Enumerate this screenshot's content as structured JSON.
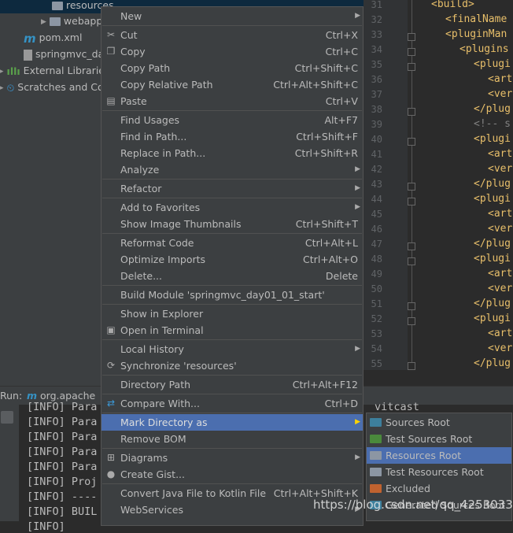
{
  "tree": [
    {
      "label": "resources",
      "icon": "folder-icon",
      "indent": 1,
      "selected": true
    },
    {
      "label": "webapp",
      "icon": "folder-icon",
      "indent": 1,
      "collapsed": true
    },
    {
      "label": "pom.xml",
      "icon": "maven-icon",
      "indent": 0
    },
    {
      "label": "springmvc_da",
      "icon": "iml-file-icon",
      "indent": 0
    },
    {
      "label": "External Libraries",
      "icon": "library-icon",
      "indent": 0
    },
    {
      "label": "Scratches and Co",
      "icon": "scratches-icon",
      "indent": 0
    }
  ],
  "editor": {
    "line_numbers": [
      "31",
      "32",
      "33",
      "34",
      "35",
      "36",
      "37",
      "38",
      "39",
      "40",
      "41",
      "42",
      "43",
      "44",
      "45",
      "46",
      "47",
      "48",
      "49",
      "50",
      "51",
      "52",
      "53",
      "54",
      "55"
    ],
    "lines": [
      {
        "text": "<build>",
        "indent": 1
      },
      {
        "text": "<finalName",
        "indent": 2
      },
      {
        "text": "<pluginMan",
        "indent": 2
      },
      {
        "text": "<plugins",
        "indent": 3
      },
      {
        "text": "<plugi",
        "indent": 4
      },
      {
        "text": "<art",
        "indent": 5
      },
      {
        "text": "<ver",
        "indent": 5
      },
      {
        "text": "</plug",
        "indent": 4
      },
      {
        "text": "<!-- s",
        "indent": 4,
        "comment": true
      },
      {
        "text": "<plugi",
        "indent": 4
      },
      {
        "text": "<art",
        "indent": 5
      },
      {
        "text": "<ver",
        "indent": 5
      },
      {
        "text": "</plug",
        "indent": 4
      },
      {
        "text": "<plugi",
        "indent": 4
      },
      {
        "text": "<art",
        "indent": 5
      },
      {
        "text": "<ver",
        "indent": 5
      },
      {
        "text": "</plug",
        "indent": 4
      },
      {
        "text": "<plugi",
        "indent": 4
      },
      {
        "text": "<art",
        "indent": 5
      },
      {
        "text": "<ver",
        "indent": 5
      },
      {
        "text": "</plug",
        "indent": 4
      },
      {
        "text": "<plugi",
        "indent": 4
      },
      {
        "text": "<art",
        "indent": 5
      },
      {
        "text": "<ver",
        "indent": 5
      },
      {
        "text": "</plug",
        "indent": 4
      }
    ]
  },
  "run": {
    "label": "Run:",
    "tab": "org.apache",
    "console": [
      "[INFO] Para",
      "[INFO] Para",
      "[INFO] Para",
      "[INFO] Para",
      "[INFO] Para",
      "[INFO] Proj",
      "[INFO] ----",
      "[INFO] BUIL",
      "[INFO]"
    ],
    "console_tail": "vitcast"
  },
  "menu": [
    {
      "label": "New",
      "submenu": true
    },
    {
      "sep": true
    },
    {
      "label": "Cut",
      "shortcut": "Ctrl+X",
      "icon": "scissors-icon",
      "glyph": "✂"
    },
    {
      "label": "Copy",
      "shortcut": "Ctrl+C",
      "icon": "copy-icon",
      "glyph": "❐"
    },
    {
      "label": "Copy Path",
      "shortcut": "Ctrl+Shift+C"
    },
    {
      "label": "Copy Relative Path",
      "shortcut": "Ctrl+Alt+Shift+C"
    },
    {
      "label": "Paste",
      "shortcut": "Ctrl+V",
      "icon": "clipboard-icon",
      "glyph": "▤"
    },
    {
      "sep": true
    },
    {
      "label": "Find Usages",
      "shortcut": "Alt+F7"
    },
    {
      "label": "Find in Path...",
      "shortcut": "Ctrl+Shift+F"
    },
    {
      "label": "Replace in Path...",
      "shortcut": "Ctrl+Shift+R"
    },
    {
      "label": "Analyze",
      "submenu": true
    },
    {
      "sep": true
    },
    {
      "label": "Refactor",
      "submenu": true
    },
    {
      "sep": true
    },
    {
      "label": "Add to Favorites",
      "submenu": true
    },
    {
      "label": "Show Image Thumbnails",
      "shortcut": "Ctrl+Shift+T"
    },
    {
      "sep": true
    },
    {
      "label": "Reformat Code",
      "shortcut": "Ctrl+Alt+L"
    },
    {
      "label": "Optimize Imports",
      "shortcut": "Ctrl+Alt+O"
    },
    {
      "label": "Delete...",
      "shortcut": "Delete"
    },
    {
      "sep": true
    },
    {
      "label": "Build Module 'springmvc_day01_01_start'"
    },
    {
      "sep": true
    },
    {
      "label": "Show in Explorer"
    },
    {
      "label": "Open in Terminal",
      "icon": "terminal-icon",
      "glyph": "▣"
    },
    {
      "sep": true
    },
    {
      "label": "Local History",
      "submenu": true
    },
    {
      "label": "Synchronize 'resources'",
      "icon": "sync-icon",
      "glyph": "⟳"
    },
    {
      "sep": true
    },
    {
      "label": "Directory Path",
      "shortcut": "Ctrl+Alt+F12"
    },
    {
      "sep": true
    },
    {
      "label": "Compare With...",
      "shortcut": "Ctrl+D",
      "icon": "compare-icon",
      "glyph": "⇄"
    },
    {
      "sep": true
    },
    {
      "label": "Mark Directory as",
      "submenu": true,
      "highlighted": true
    },
    {
      "label": "Remove BOM"
    },
    {
      "sep": true
    },
    {
      "label": "Diagrams",
      "submenu": true,
      "icon": "diagram-icon",
      "glyph": "⊞"
    },
    {
      "label": "Create Gist...",
      "icon": "github-icon",
      "glyph": "●"
    },
    {
      "sep": true
    },
    {
      "label": "Convert Java File to Kotlin File",
      "shortcut": "Ctrl+Alt+Shift+K"
    },
    {
      "label": "WebServices",
      "submenu": true
    }
  ],
  "submenu": [
    {
      "label": "Sources Root",
      "color": "#3d7f9c"
    },
    {
      "label": "Test Sources Root",
      "color": "#4a8a3c"
    },
    {
      "label": "Resources Root",
      "color": "#8c96a3",
      "highlighted": true
    },
    {
      "label": "Test Resources Root",
      "color": "#8c96a3"
    },
    {
      "label": "Excluded",
      "color": "#c0622f"
    },
    {
      "label": "Generated Sources Root",
      "color": "#3d7f9c"
    }
  ],
  "watermark": "https://blog.csdn.net/qq_42530332",
  "colors": {
    "highlight": "#4b6eaf",
    "menu_bg": "#3c3f41",
    "xml_tag": "#e8bf6a"
  }
}
